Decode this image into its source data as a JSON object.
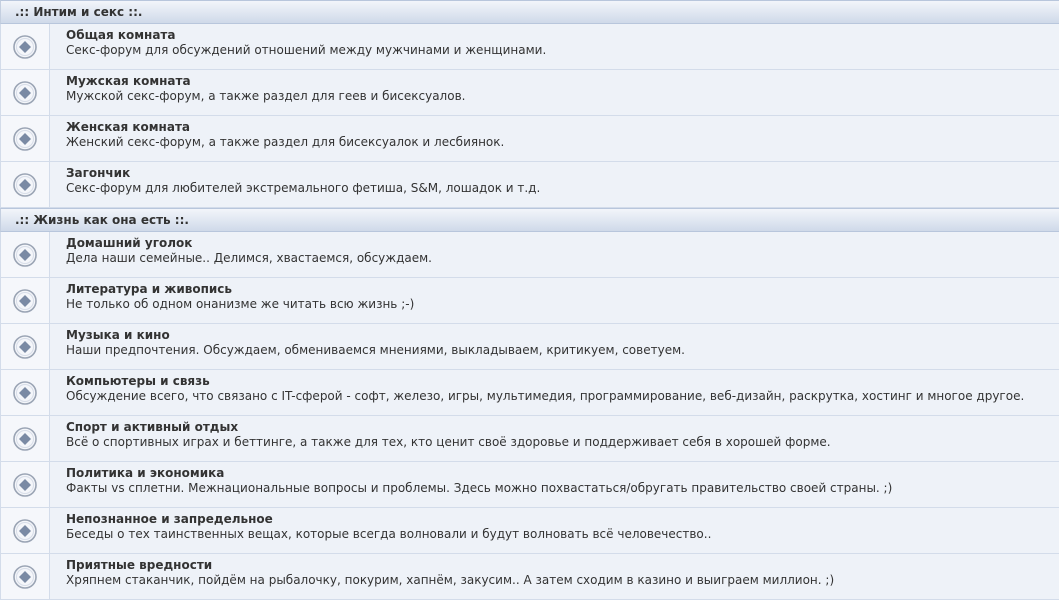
{
  "categories": [
    {
      "title": ".:: Интим и секс ::.",
      "forums": [
        {
          "title": "Общая комната",
          "desc": "Секс-форум для обсуждений отношений между мужчинами и женщинами."
        },
        {
          "title": "Мужская комната",
          "desc": "Мужской секс-форум, а также раздел для геев и бисексуалов."
        },
        {
          "title": "Женская комната",
          "desc": "Женский секс-форум, а также раздел для бисексуалок и лесбиянок."
        },
        {
          "title": "Загончик",
          "desc": "Секс-форум для любителей экстремального фетиша, S&M, лошадок и т.д."
        }
      ]
    },
    {
      "title": ".:: Жизнь как она есть ::.",
      "forums": [
        {
          "title": "Домашний уголок",
          "desc": "Дела наши семейные.. Делимся, хвастаемся, обсуждаем."
        },
        {
          "title": "Литература и живопись",
          "desc": "Не только об одном онанизме же читать всю жизнь ;-)"
        },
        {
          "title": "Музыка и кино",
          "desc": "Наши предпочтения. Обсуждаем, обмениваемся мнениями, выкладываем, критикуем, советуем."
        },
        {
          "title": "Компьютеры и связь",
          "desc": "Обсуждение всего, что связано с IT-сферой - софт, железо, игры, мультимедия, программирование, веб-дизайн, раскрутка, хостинг и многое другое."
        },
        {
          "title": "Спорт и активный отдых",
          "desc": "Всё о спортивных играх и беттинге, а также для тех, кто ценит своё здоровье и поддерживает себя в хорошей форме."
        },
        {
          "title": "Политика и экономика",
          "desc": "Факты vs сплетни. Межнациональные вопросы и проблемы. Здесь можно похвастаться/обругать правительство своей страны. ;)"
        },
        {
          "title": "Непознанное и запредельное",
          "desc": "Беседы о тех таинственных вещах, которые всегда волновали и будут волновать всё человечество.."
        },
        {
          "title": "Приятные вредности",
          "desc": "Хряпнем стаканчик, пойдём на рыбалочку, покурим, хапнём, закусим.. А затем сходим в казино и выиграем миллион. ;)"
        }
      ]
    }
  ],
  "icon": {
    "name": "forum-read-icon",
    "ring_color": "#9aa4b4",
    "fill_color": "#f4f6fa",
    "diamond_color": "#7a8aa4"
  }
}
